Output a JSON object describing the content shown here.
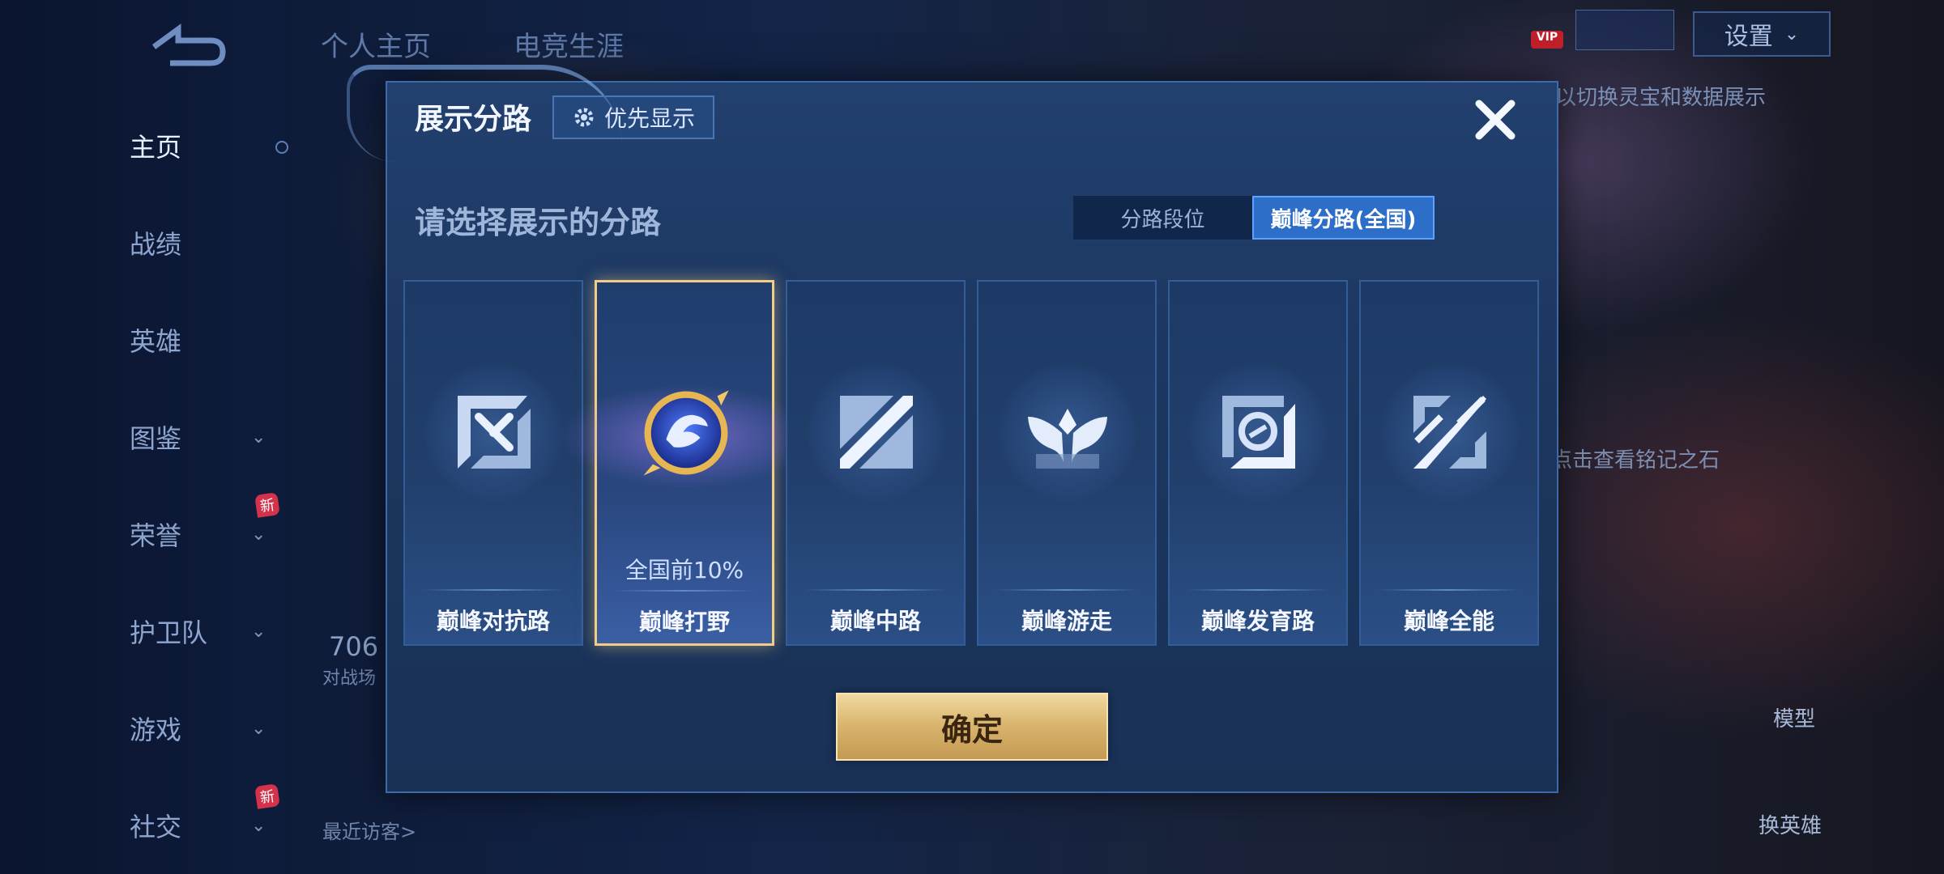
{
  "sidebar": {
    "items": [
      {
        "label": "主页",
        "active": true
      },
      {
        "label": "战绩"
      },
      {
        "label": "英雄"
      },
      {
        "label": "图鉴"
      },
      {
        "label": "荣誉"
      },
      {
        "label": "护卫队"
      },
      {
        "label": "游戏"
      },
      {
        "label": "社交"
      }
    ],
    "new_badge": "新"
  },
  "top_tabs": [
    "个人主页",
    "电竞生涯"
  ],
  "settings_label": "设置",
  "vip_label": "VIP",
  "background_hints": {
    "hint1": "以切换灵宝和数据展示",
    "hint2": "点击查看铭记之石",
    "model": "模型",
    "switch_hero": "换英雄",
    "recent_visitors": "最近访客>",
    "stat_number": "706",
    "stat_label": "对战场"
  },
  "modal": {
    "title": "展示分路",
    "priority_button": "优先显示",
    "subtitle": "请选择展示的分路",
    "tabs": [
      {
        "label": "分路段位",
        "active": false
      },
      {
        "label": "巅峰分路(全国)",
        "active": true
      }
    ],
    "lanes": [
      {
        "label": "巅峰对抗路",
        "icon": "sword-cross-icon",
        "selected": false,
        "rank": ""
      },
      {
        "label": "巅峰打野",
        "icon": "dragon-emblem-icon",
        "selected": true,
        "rank": "全国前10%"
      },
      {
        "label": "巅峰中路",
        "icon": "slash-icon",
        "selected": false,
        "rank": ""
      },
      {
        "label": "巅峰游走",
        "icon": "wings-icon",
        "selected": false,
        "rank": ""
      },
      {
        "label": "巅峰发育路",
        "icon": "target-icon",
        "selected": false,
        "rank": ""
      },
      {
        "label": "巅峰全能",
        "icon": "crossed-blades-icon",
        "selected": false,
        "rank": ""
      }
    ],
    "confirm": "确定"
  },
  "colors": {
    "selected_border": "#f3cd85",
    "tab_active": "#2d6fc8",
    "confirm_gold": "#d8b36c"
  }
}
